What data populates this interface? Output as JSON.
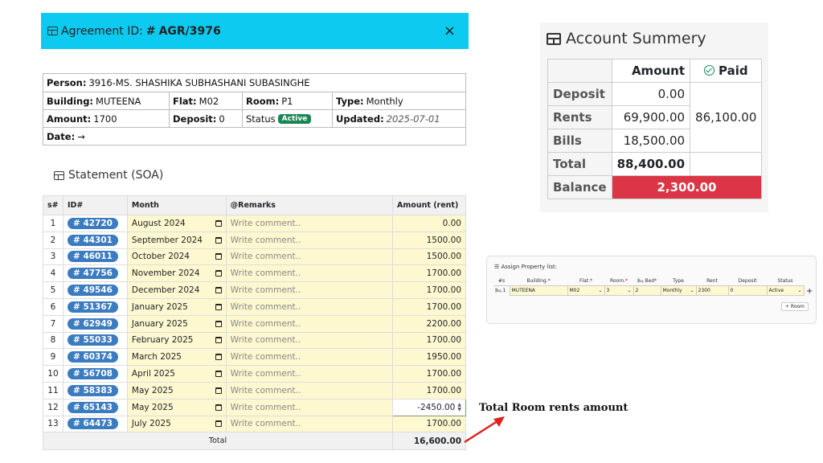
{
  "agreement": {
    "id_label": "Agreement ID:",
    "id_hash": "#",
    "id_value": "AGR/3976",
    "close": "×"
  },
  "details": {
    "person_label": "Person:",
    "person_value": "3916-MS. SHASHIKA SUBHASHANI SUBASINGHE",
    "building_label": "Building:",
    "building_value": "MUTEENA",
    "flat_label": "Flat:",
    "flat_value": "M02",
    "room_label": "Room:",
    "room_value": "P1",
    "type_label": "Type:",
    "type_value": "Monthly",
    "amount_label": "Amount:",
    "amount_value": "1700",
    "deposit_label": "Deposit:",
    "deposit_value": "0",
    "status_label": "Status",
    "status_value": "Active",
    "updated_label": "Updated:",
    "updated_value": "2025-07-01",
    "date_label": "Date:",
    "date_value": "→"
  },
  "statement": {
    "title": "Statement (SOA)",
    "headers": [
      "s#",
      "ID#",
      "Month",
      "@Remarks",
      "Amount (rent)"
    ],
    "remark_placeholder": "Write comment..",
    "rows": [
      {
        "sn": "1",
        "id": "# 42720",
        "month": "August 2024",
        "amount": "0.00"
      },
      {
        "sn": "2",
        "id": "# 44301",
        "month": "September 2024",
        "amount": "1500.00"
      },
      {
        "sn": "3",
        "id": "# 46011",
        "month": "October 2024",
        "amount": "1500.00"
      },
      {
        "sn": "4",
        "id": "# 47756",
        "month": "November 2024",
        "amount": "1700.00"
      },
      {
        "sn": "5",
        "id": "# 49546",
        "month": "December 2024",
        "amount": "1700.00"
      },
      {
        "sn": "6",
        "id": "# 51367",
        "month": "January 2025",
        "amount": "1700.00"
      },
      {
        "sn": "7",
        "id": "# 62949",
        "month": "January 2025",
        "amount": "2200.00"
      },
      {
        "sn": "8",
        "id": "# 55033",
        "month": "February 2025",
        "amount": "1700.00"
      },
      {
        "sn": "9",
        "id": "# 60374",
        "month": "March 2025",
        "amount": "1950.00"
      },
      {
        "sn": "10",
        "id": "# 56708",
        "month": "April 2025",
        "amount": "1700.00"
      },
      {
        "sn": "11",
        "id": "# 58383",
        "month": "May 2025",
        "amount": "1700.00"
      },
      {
        "sn": "12",
        "id": "# 65143",
        "month": "May 2025",
        "amount": "-2450.00"
      },
      {
        "sn": "13",
        "id": "# 64473",
        "month": "July 2025",
        "amount": "1700.00"
      }
    ],
    "total_label": "Total",
    "total_value": "16,600.00"
  },
  "annotation": {
    "text": "Total Room rents amount",
    "color": "#e02020"
  },
  "account": {
    "title": "Account Summery",
    "amount_header": "Amount",
    "paid_header": "Paid",
    "deposit_label": "Deposit",
    "deposit_value": "0.00",
    "rents_label": "Rents",
    "rents_value": "69,900.00",
    "bills_label": "Bills",
    "bills_value": "18,500.00",
    "total_label": "Total",
    "total_value": "88,400.00",
    "paid_value": "86,100.00",
    "balance_label": "Balance",
    "balance_value": "2,300.00",
    "balance_color": "#dc3545"
  },
  "assign": {
    "title": "☰ Assign Property list:",
    "headers": [
      "#s",
      "Building.",
      "Flat.",
      "Room.",
      "Bed",
      "Type",
      "Rent",
      "Deposit",
      "Status"
    ],
    "row": {
      "num": "1",
      "building": "MUTEENA",
      "flat": "M02",
      "room": "3",
      "bed": "2",
      "type": "Monthly",
      "rent": "2300",
      "deposit": "0",
      "status": "Active"
    },
    "add_room": "+ Room",
    "plus": "+"
  }
}
